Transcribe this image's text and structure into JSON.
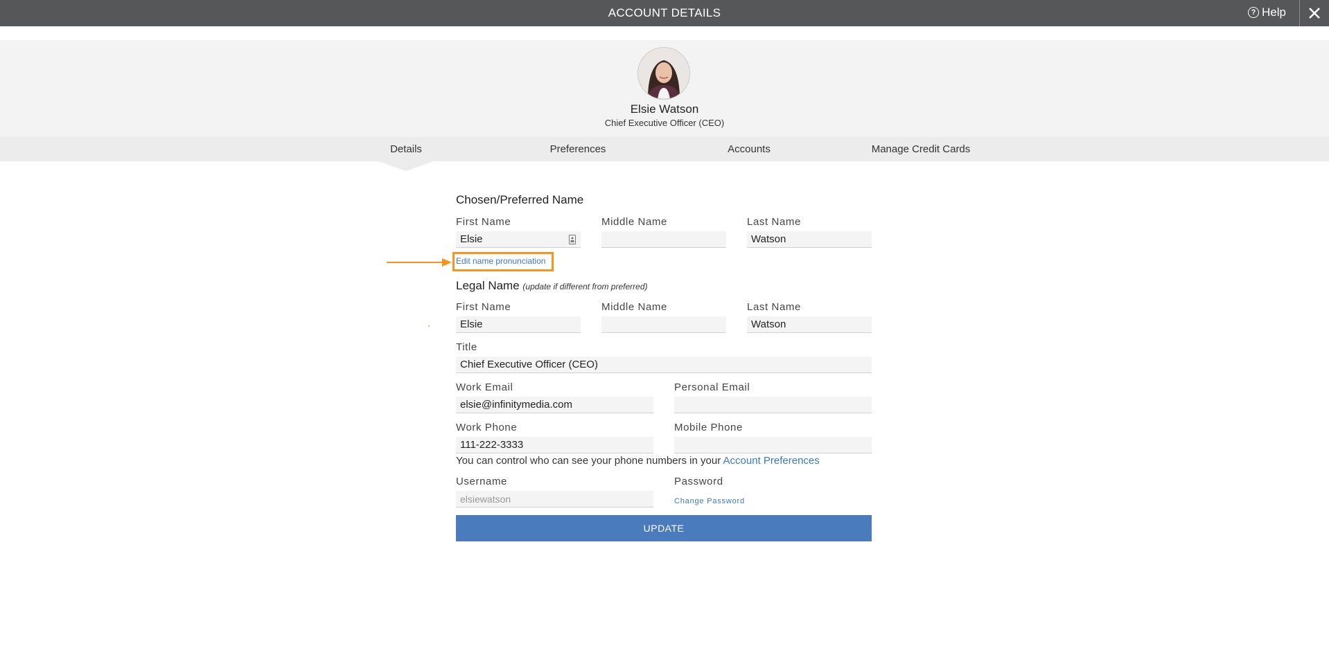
{
  "header": {
    "title": "ACCOUNT DETAILS",
    "help_label": "Help"
  },
  "profile": {
    "name": "Elsie Watson",
    "title": "Chief Executive Officer (CEO)"
  },
  "tabs": [
    "Details",
    "Preferences",
    "Accounts",
    "Manage Credit Cards"
  ],
  "active_tab": "Details",
  "chosen_name": {
    "heading": "Chosen/Preferred Name",
    "first_label": "First Name",
    "first_value": "Elsie",
    "middle_label": "Middle Name",
    "middle_value": "",
    "last_label": "Last Name",
    "last_value": "Watson",
    "pronunciation_link": "Edit name pronunciation"
  },
  "legal_name": {
    "heading": "Legal Name",
    "subheading": "(update if different from preferred)",
    "first_label": "First Name",
    "first_value": "Elsie",
    "middle_label": "Middle Name",
    "middle_value": "",
    "last_label": "Last Name",
    "last_value": "Watson"
  },
  "title_field": {
    "label": "Title",
    "value": "Chief Executive Officer (CEO)"
  },
  "work_email": {
    "label": "Work Email",
    "value": "elsie@infinitymedia.com"
  },
  "personal_email": {
    "label": "Personal Email",
    "value": ""
  },
  "work_phone": {
    "label": "Work Phone",
    "value": "111-222-3333"
  },
  "mobile_phone": {
    "label": "Mobile Phone",
    "value": ""
  },
  "phone_note": {
    "text": "You can control who can see your phone numbers in your",
    "link": "Account Preferences"
  },
  "username": {
    "label": "Username",
    "value": "elsiewatson"
  },
  "password": {
    "label": "Password",
    "link": "Change Password"
  },
  "update_button": "UPDATE",
  "colors": {
    "header_bg": "#555759",
    "accent_blue": "#4a7bbc",
    "link_blue": "#3a78c4",
    "highlight_orange": "#f7941d"
  }
}
